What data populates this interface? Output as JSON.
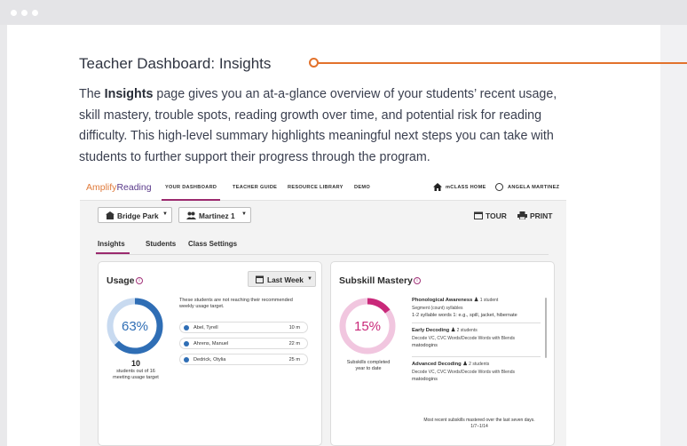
{
  "doc": {
    "title": "Teacher Dashboard: Insights",
    "intro_pre": "The ",
    "intro_bold": "Insights",
    "intro_post": " page gives you an at-a-glance overview of your students’ recent usage, skill mastery, trouble spots, reading growth over time, and potential risk for reading difficulty. This high-level summary highlights meaningful next steps you can take with students to further support their progress through the program."
  },
  "app": {
    "logo_a": "Amplify",
    "logo_b": "Reading",
    "nav": [
      "YOUR DASHBOARD",
      "TEACHER GUIDE",
      "RESOURCE LIBRARY",
      "DEMO"
    ],
    "class_home": "mCLASS HOME",
    "user_name": "ANGELA MARTINEZ",
    "school_select": "Bridge Park",
    "class_select": "Martinez 1",
    "tour": "TOUR",
    "print": "PRINT",
    "tabs": [
      "Insights",
      "Students",
      "Class Settings"
    ],
    "usage": {
      "title": "Usage",
      "range_select": "Last Week",
      "percent_label": "63%",
      "percent_value": 63,
      "count": "10",
      "count_caption_1": "students out of 16",
      "count_caption_2": "meeting usage target",
      "note_1": "These students are not reaching their recommended",
      "note_2": "weekly usage target.",
      "students": [
        {
          "name": "Abel, Tyrell",
          "minutes": "10 m"
        },
        {
          "name": "Ahrens, Manuel",
          "minutes": "22 m"
        },
        {
          "name": "Dedrick, Otylia",
          "minutes": "25 m"
        }
      ]
    },
    "mastery": {
      "title": "Subskill Mastery",
      "percent_label": "15%",
      "percent_value": 15,
      "caption_1": "Subskills completed",
      "caption_2": "year to date",
      "skills": [
        {
          "name": "Phonological Awareness",
          "count": "1 student",
          "sub": "Segment (count) syllables",
          "example": "1-2 syllable words 1: e.g., spill, jacket, hibernate"
        },
        {
          "name": "Early Decoding",
          "count": "2 students",
          "sub": "Decode VC, CVC Words/Decode Words with Blends",
          "example": "matodogins"
        },
        {
          "name": "Advanced Decoding",
          "count": "2 students",
          "sub": "Decode VC, CVC Words/Decode Words with Blends",
          "example": "matodogins"
        }
      ],
      "footer_1": "Most recent subskills mastered over the last seven days.",
      "footer_2": "1/7–1/14"
    }
  },
  "colors": {
    "accent_orange": "#e2722c",
    "accent_magenta": "#9b2a6e",
    "usage_blue": "#2f6eb5",
    "usage_track": "#c8daf0",
    "mastery_pink": "#c9297a",
    "mastery_track": "#f1c6df"
  }
}
